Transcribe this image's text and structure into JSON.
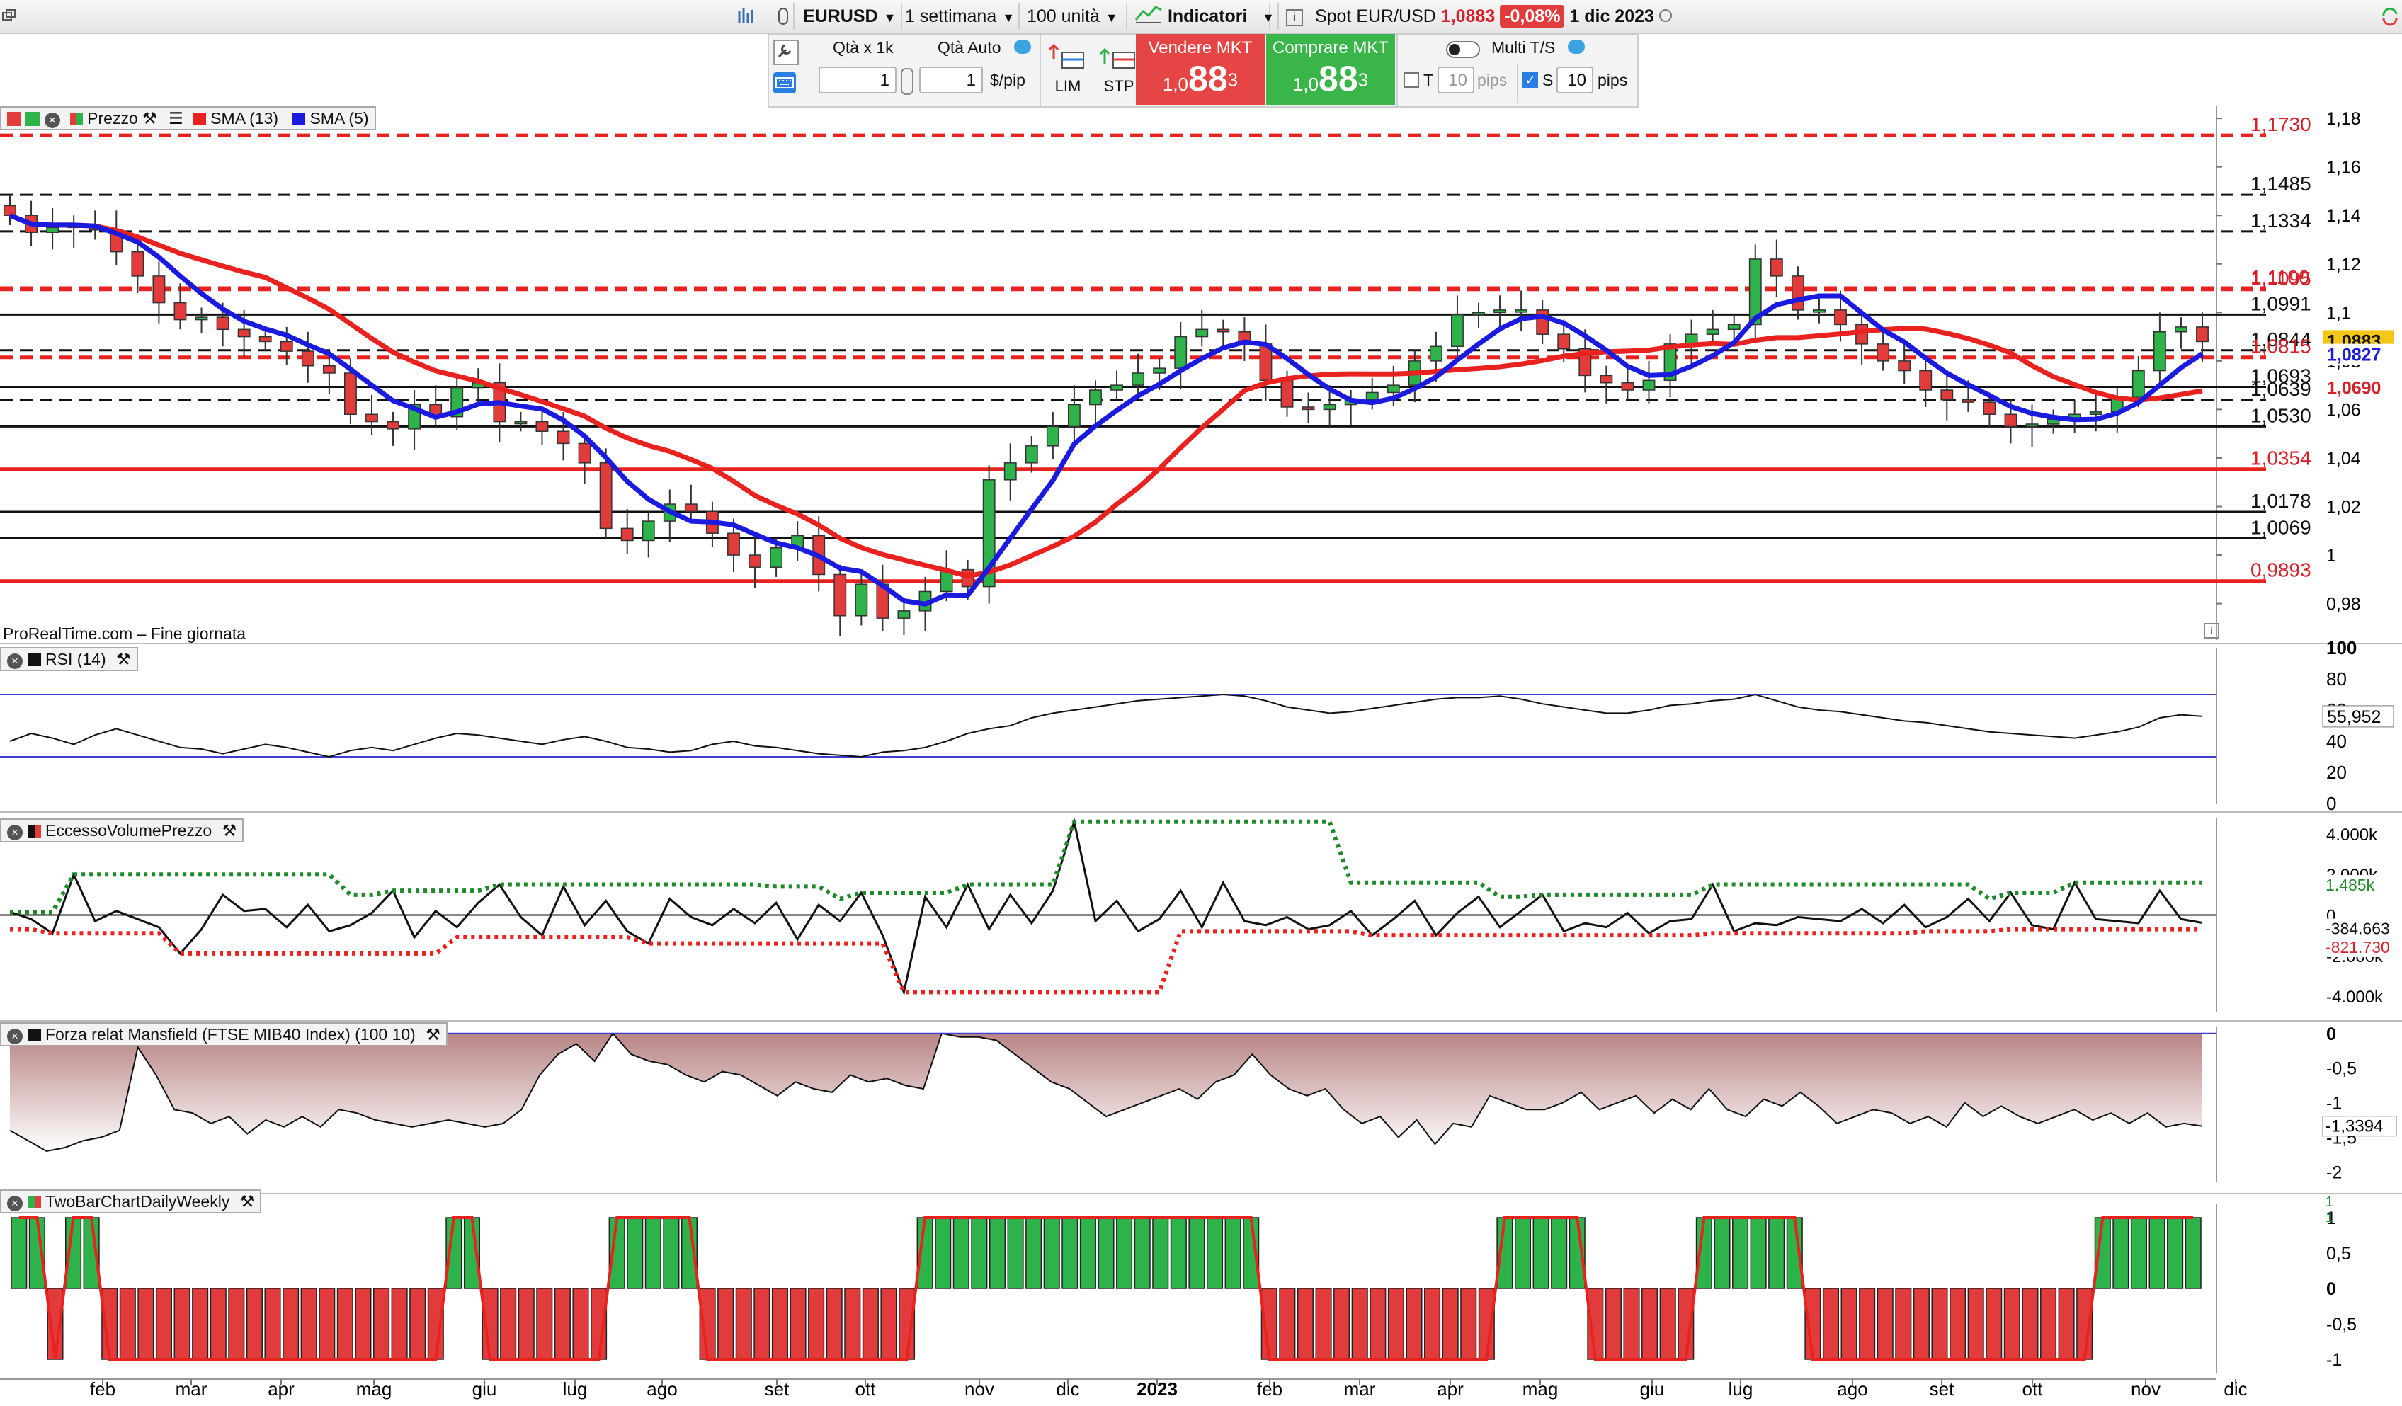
{
  "topbar": {
    "window_icon": "restore-window-icon",
    "symbol": "EURUSD",
    "timeframe": "1 settimana",
    "quantity": "100 unità",
    "indicators_label": "Indicatori",
    "spot_label": "Spot EUR/USD",
    "spot_price": "1,0883",
    "spot_change": "-0,08%",
    "date": "1 dic 2023"
  },
  "orderbar": {
    "qty_label": "Qtà  x 1k",
    "qty_auto_label": "Qtà Auto",
    "qty_value": "1",
    "qty_value2": "1",
    "per_pip": "$/pip",
    "lim_label": "LIM",
    "stp_label": "STP",
    "sell_label": "Vendere MKT",
    "buy_label": "Comprare MKT",
    "price_prefix": "1,0",
    "price_big": "88",
    "price_sup": "3",
    "multi_ts_label": "Multi T/S",
    "t_label": "T",
    "t_value": "10",
    "t_unit": "pips",
    "s_label": "S",
    "s_value": "10",
    "s_unit": "pips"
  },
  "price_panel": {
    "legend_price": "Prezzo",
    "legend_sma13": "SMA (13)",
    "legend_sma5": "SMA (5)",
    "watermark": "ProRealTime.com – Fine giornata",
    "current_price_tag": "1,0883",
    "sma5_tag": "1,0827",
    "sma13_tag": "1,0690",
    "colors": {
      "up": "#2db34a",
      "down": "#e23b3b",
      "sma13": "#e8231f",
      "sma5": "#1b1be0"
    }
  },
  "chart_data": [
    {
      "type": "candlestick",
      "name": "EURUSD weekly",
      "y_ticks": [
        "1,18",
        "1,16",
        "1,14",
        "1,12",
        "1,1",
        "1,08",
        "1,06",
        "1,04",
        "1,02",
        "1",
        "0,98"
      ],
      "ylim": [
        0.965,
        1.185
      ],
      "x_labels": [
        "feb",
        "mar",
        "apr",
        "mag",
        "giu",
        "lug",
        "ago",
        "set",
        "ott",
        "nov",
        "dic",
        "2023",
        "feb",
        "mar",
        "apr",
        "mag",
        "giu",
        "lug",
        "ago",
        "set",
        "ott",
        "nov",
        "dic"
      ],
      "close": [
        1.14,
        1.133,
        1.135,
        1.136,
        1.134,
        1.125,
        1.115,
        1.104,
        1.097,
        1.098,
        1.093,
        1.09,
        1.088,
        1.084,
        1.078,
        1.075,
        1.058,
        1.055,
        1.052,
        1.062,
        1.057,
        1.069,
        1.071,
        1.055,
        1.055,
        1.051,
        1.046,
        1.038,
        1.011,
        1.006,
        1.014,
        1.021,
        1.018,
        1.009,
        1.0,
        0.995,
        1.003,
        1.008,
        0.992,
        0.975,
        0.988,
        0.974,
        0.977,
        0.985,
        0.994,
        0.987,
        1.031,
        1.038,
        1.045,
        1.053,
        1.062,
        1.068,
        1.07,
        1.075,
        1.077,
        1.09,
        1.093,
        1.092,
        1.087,
        1.072,
        1.061,
        1.06,
        1.062,
        1.064,
        1.067,
        1.07,
        1.08,
        1.086,
        1.099,
        1.1,
        1.101,
        1.101,
        1.091,
        1.085,
        1.074,
        1.071,
        1.068,
        1.072,
        1.087,
        1.091,
        1.093,
        1.095,
        1.122,
        1.115,
        1.101,
        1.101,
        1.095,
        1.087,
        1.08,
        1.076,
        1.068,
        1.064,
        1.063,
        1.058,
        1.053,
        1.054,
        1.056,
        1.058,
        1.059,
        1.065,
        1.076,
        1.092,
        1.094,
        1.088
      ],
      "sma13_tail": [
        1.069,
        1.069
      ],
      "horizontal_lines": [
        {
          "value": 1.173,
          "label": "1,1730",
          "style": "dashed",
          "color": "#e8231f"
        },
        {
          "value": 1.1485,
          "label": "1,1485",
          "style": "dashed",
          "color": "#111111"
        },
        {
          "value": 1.1334,
          "label": "1,1334",
          "style": "dashed",
          "color": "#111111"
        },
        {
          "value": 1.11,
          "label": "1,1100",
          "style": "dashed",
          "color": "#e8231f"
        },
        {
          "value": 1.1095,
          "label": "1,1095",
          "style": "dashed",
          "color": "#e8231f"
        },
        {
          "value": 1.0991,
          "label": "1,0991",
          "style": "solid",
          "color": "#111111"
        },
        {
          "value": 1.0844,
          "label": "1,0844",
          "style": "dashed",
          "color": "#111111"
        },
        {
          "value": 1.0815,
          "label": "1,0815",
          "style": "dashed",
          "color": "#e8231f"
        },
        {
          "value": 1.0693,
          "label": "1,0693",
          "style": "solid",
          "color": "#111111"
        },
        {
          "value": 1.0639,
          "label": "1,0639",
          "style": "dashed",
          "color": "#111111"
        },
        {
          "value": 1.053,
          "label": "1,0530",
          "style": "solid",
          "color": "#111111"
        },
        {
          "value": 1.0354,
          "label": "1,0354",
          "style": "solid",
          "color": "#e8231f"
        },
        {
          "value": 1.0178,
          "label": "1,0178",
          "style": "solid",
          "color": "#111111"
        },
        {
          "value": 1.0069,
          "label": "1,0069",
          "style": "solid",
          "color": "#111111"
        },
        {
          "value": 0.9893,
          "label": "0,9893",
          "style": "solid",
          "color": "#e8231f"
        }
      ]
    },
    {
      "type": "line",
      "name": "RSI (14)",
      "y_ticks": [
        "100",
        "80",
        "60",
        "40",
        "20",
        "0"
      ],
      "ylim": [
        0,
        100
      ],
      "bands": [
        30,
        70
      ],
      "last_value_label": "55,952",
      "values": [
        40,
        45,
        42,
        38,
        44,
        48,
        44,
        40,
        36,
        35,
        32,
        35,
        38,
        36,
        33,
        30,
        34,
        36,
        34,
        38,
        42,
        45,
        44,
        42,
        40,
        38,
        41,
        43,
        40,
        36,
        35,
        33,
        34,
        38,
        40,
        37,
        36,
        34,
        32,
        31,
        30,
        33,
        34,
        36,
        40,
        45,
        48,
        50,
        55,
        58,
        60,
        62,
        64,
        66,
        67,
        68,
        69,
        70,
        69,
        66,
        62,
        60,
        58,
        59,
        61,
        63,
        65,
        67,
        68,
        68,
        69,
        67,
        64,
        62,
        60,
        58,
        58,
        60,
        63,
        64,
        66,
        67,
        70,
        66,
        62,
        60,
        59,
        57,
        55,
        53,
        52,
        50,
        48,
        46,
        45,
        44,
        43,
        42,
        44,
        46,
        49,
        55,
        57,
        55.952
      ]
    },
    {
      "type": "line",
      "name": "EccessoVolumePrezzo",
      "y_ticks": [
        "4.000k",
        "2.000k",
        "0",
        "-2.000k",
        "-4.000k"
      ],
      "ylim": [
        -4800,
        4800
      ],
      "upper_label": "1.485k",
      "last_label": "-384.663",
      "lower_label": "-821.730",
      "values": [
        150,
        -200,
        -900,
        2000,
        -300,
        200,
        -200,
        -600,
        -1900,
        -700,
        1000,
        200,
        300,
        -600,
        500,
        -800,
        -500,
        100,
        1200,
        -1100,
        200,
        -600,
        600,
        1500,
        -100,
        -1000,
        1400,
        -500,
        700,
        -800,
        -1400,
        800,
        -100,
        -500,
        300,
        -400,
        600,
        -1200,
        500,
        -300,
        1100,
        -1000,
        -3800,
        900,
        -600,
        1500,
        -700,
        1000,
        -400,
        1200,
        4600,
        -300,
        700,
        -800,
        -200,
        1200,
        -600,
        1600,
        -300,
        -500,
        -100,
        -700,
        -500,
        200,
        -1000,
        -200,
        700,
        -1000,
        100,
        900,
        -600,
        200,
        1000,
        -800,
        -400,
        -600,
        100,
        -900,
        -300,
        -200,
        1500,
        -800,
        -400,
        -500,
        -100,
        -200,
        -300,
        300,
        -400,
        500,
        -600,
        -100,
        800,
        -300,
        1100,
        -500,
        -700,
        1600,
        -200,
        -300,
        -400,
        1200,
        -200,
        -384.663
      ]
    },
    {
      "type": "area",
      "name": "Forza relat Mansfield (FTSE MIB40 Index) (100 10)",
      "y_ticks": [
        "0",
        "-0,5",
        "-1",
        "-1,5",
        "-2"
      ],
      "ylim": [
        -2.15,
        0.1
      ],
      "last_value_label": "-1,3394",
      "values": [
        -1.4,
        -1.55,
        -1.7,
        -1.65,
        -1.55,
        -1.5,
        -1.4,
        -0.2,
        -0.6,
        -1.1,
        -1.15,
        -1.3,
        -1.2,
        -1.45,
        -1.25,
        -1.35,
        -1.2,
        -1.35,
        -1.1,
        -1.15,
        -1.25,
        -1.3,
        -1.35,
        -1.3,
        -1.25,
        -1.3,
        -1.35,
        -1.3,
        -1.1,
        -0.6,
        -0.3,
        -0.15,
        -0.4,
        0.0,
        -0.3,
        -0.4,
        -0.45,
        -0.6,
        -0.7,
        -0.55,
        -0.6,
        -0.75,
        -0.9,
        -0.7,
        -0.8,
        -0.85,
        -0.6,
        -0.7,
        -0.65,
        -0.75,
        -0.8,
        0.0,
        -0.05,
        -0.05,
        -0.1,
        -0.3,
        -0.5,
        -0.7,
        -0.8,
        -1.0,
        -1.2,
        -1.1,
        -1.0,
        -0.9,
        -0.8,
        -0.95,
        -0.7,
        -0.6,
        -0.3,
        -0.6,
        -0.8,
        -0.9,
        -0.8,
        -1.1,
        -1.3,
        -1.2,
        -1.5,
        -1.25,
        -1.6,
        -1.3,
        -1.35,
        -0.9,
        -1.0,
        -1.1,
        -1.1,
        -1.0,
        -0.85,
        -1.1,
        -1.0,
        -0.9,
        -1.15,
        -0.95,
        -1.1,
        -0.8,
        -1.1,
        -1.2,
        -0.95,
        -1.05,
        -0.85,
        -1.05,
        -1.3,
        -1.2,
        -1.1,
        -1.15,
        -1.3,
        -1.2,
        -1.35,
        -1.0,
        -1.2,
        -1.05,
        -1.2,
        -1.3,
        -1.2,
        -1.1,
        -1.25,
        -1.15,
        -1.3,
        -1.15,
        -1.35,
        -1.3,
        -1.3394
      ]
    },
    {
      "type": "bar",
      "name": "TwoBarChartDailyWeekly",
      "y_ticks": [
        "1",
        "0,5",
        "0",
        "-0,5",
        "-1"
      ],
      "ylim": [
        -1.2,
        1.2
      ],
      "top_labels": [
        "1",
        "1"
      ],
      "values": [
        1,
        1,
        -1,
        1,
        1,
        -1,
        -1,
        -1,
        -1,
        -1,
        -1,
        -1,
        -1,
        -1,
        -1,
        -1,
        -1,
        -1,
        -1,
        -1,
        -1,
        -1,
        -1,
        -1,
        1,
        1,
        -1,
        -1,
        -1,
        -1,
        -1,
        -1,
        -1,
        1,
        1,
        1,
        1,
        1,
        -1,
        -1,
        -1,
        -1,
        -1,
        -1,
        -1,
        -1,
        -1,
        -1,
        -1,
        -1,
        1,
        1,
        1,
        1,
        1,
        1,
        1,
        1,
        1,
        1,
        1,
        1,
        1,
        1,
        1,
        1,
        1,
        1,
        1,
        -1,
        -1,
        -1,
        -1,
        -1,
        -1,
        -1,
        -1,
        -1,
        -1,
        -1,
        -1,
        -1,
        1,
        1,
        1,
        1,
        1,
        -1,
        -1,
        -1,
        -1,
        -1,
        -1,
        1,
        1,
        1,
        1,
        1,
        1,
        -1,
        -1,
        -1,
        -1,
        -1,
        -1,
        -1,
        -1,
        -1,
        -1,
        -1,
        -1,
        -1,
        -1,
        -1,
        -1,
        1,
        1,
        1,
        1,
        1,
        1
      ]
    }
  ]
}
